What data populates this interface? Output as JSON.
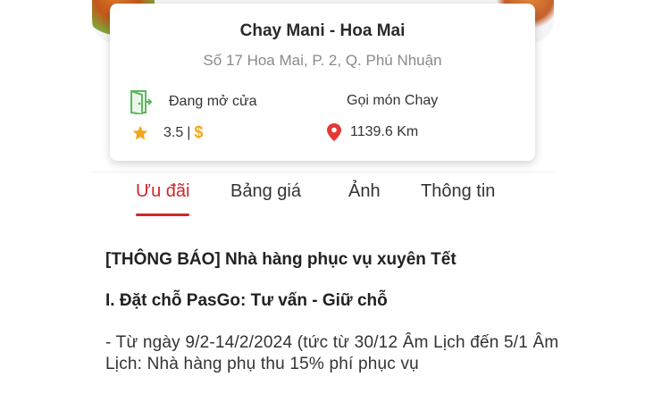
{
  "restaurant": {
    "name": "Chay Mani - Hoa Mai",
    "address": "Số 17 Hoa Mai, P. 2, Q. Phú Nhuận",
    "status": "Đang mở cửa",
    "category": "Gọi món Chay",
    "rating": "3.5",
    "rating_separator": "|",
    "price_symbol": "$",
    "distance": "1139.6 Km"
  },
  "icons": {
    "status": "door-open-icon",
    "rating": "star-icon",
    "distance": "map-pin-icon"
  },
  "tabs": [
    {
      "label": "Ưu đãi",
      "active": true
    },
    {
      "label": "Bảng giá",
      "active": false
    },
    {
      "label": "Ảnh",
      "active": false
    },
    {
      "label": "Thông tin",
      "active": false
    }
  ],
  "content": {
    "announcement": "[THÔNG BÁO] Nhà hàng phục vụ xuyên Tết",
    "section_title": "I. Đặt chỗ PasGo: Tư vấn - Giữ chỗ",
    "paragraph": "- Từ ngày 9/2-14/2/2024 (tức từ 30/12 Âm Lịch đến 5/1 Âm Lịch: Nhà hàng phụ thu 15% phí phục vụ"
  },
  "colors": {
    "accent": "#d0262c",
    "door_icon": "#5cb85c",
    "star": "#f2a71b",
    "pin": "#e53935"
  }
}
